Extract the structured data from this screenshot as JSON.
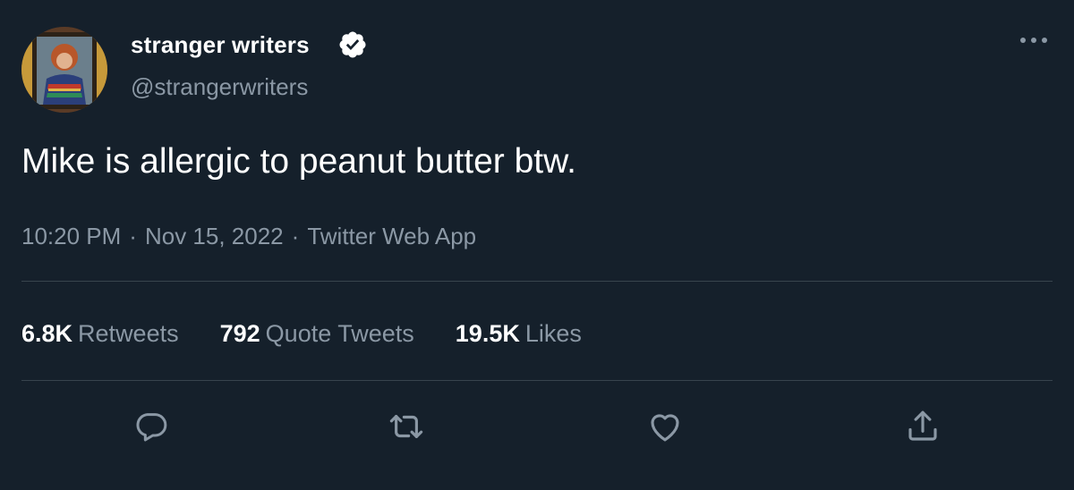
{
  "author": {
    "display_name": "stranger writers",
    "handle": "@strangerwriters",
    "verified": true
  },
  "tweet": {
    "text": "Mike is allergic to peanut butter btw.",
    "time": "10:20 PM",
    "date": "Nov 15, 2022",
    "source": "Twitter Web App",
    "separator": "·"
  },
  "stats": {
    "retweets": {
      "count": "6.8K",
      "label": "Retweets"
    },
    "quotes": {
      "count": "792",
      "label": "Quote Tweets"
    },
    "likes": {
      "count": "19.5K",
      "label": "Likes"
    }
  },
  "icons": {
    "more": "more-horizontal-icon",
    "verified": "verified-badge-icon",
    "reply": "reply-icon",
    "retweet": "retweet-icon",
    "like": "heart-icon",
    "share": "share-icon"
  },
  "colors": {
    "background": "#15202b",
    "text_primary": "#ffffff",
    "text_secondary": "#8b98a5",
    "divider": "#38444d"
  }
}
